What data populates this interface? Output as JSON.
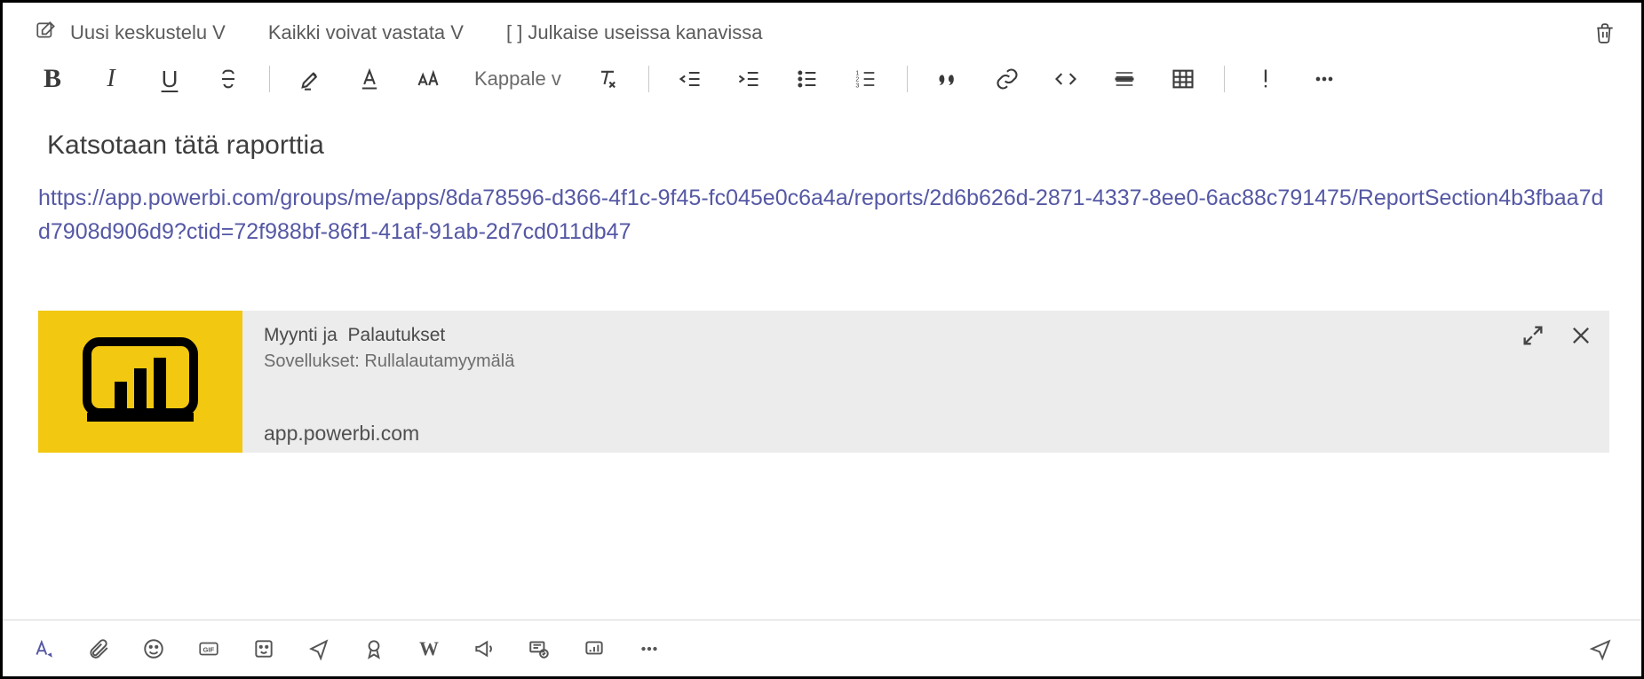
{
  "topbar": {
    "new_conversation": "Uusi keskustelu V",
    "reply_setting": "Kaikki voivat vastata V",
    "post_channels": "[ ] Julkaise useissa kanavissa"
  },
  "format": {
    "paragraph_label": "Kappale v"
  },
  "message": {
    "title": "Katsotaan tätä raporttia",
    "link": "https://app.powerbi.com/groups/me/apps/8da78596-d366-4f1c-9f45-fc045e0c6a4a/reports/2d6b626d-2871-4337-8ee0-6ac88c791475/ReportSection4b3fbaa7dd7908d906d9?ctid=72f988bf-86f1-41af-91ab-2d7cd011db47"
  },
  "preview": {
    "title_line1": "Myynti ja",
    "title_line2": "Palautukset",
    "subtitle_line": "Sovellukset: Rullalautamyymälä",
    "domain": "app.powerbi.com"
  }
}
